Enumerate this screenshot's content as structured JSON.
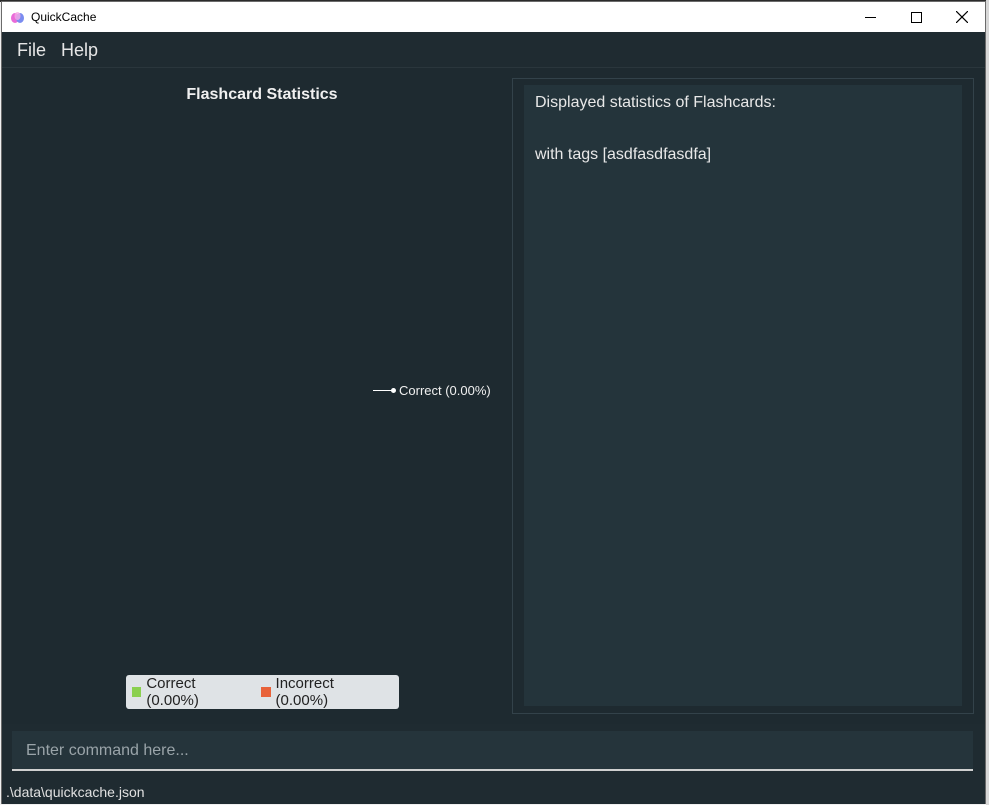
{
  "window": {
    "title": "QuickCache"
  },
  "menu": {
    "items": [
      {
        "label": "File"
      },
      {
        "label": "Help"
      }
    ]
  },
  "chart": {
    "title": "Flashcard Statistics",
    "slice_label": "Correct (0.00%)",
    "legend": [
      {
        "label": "Correct (0.00%)",
        "color": "#8ad04f"
      },
      {
        "label": "Incorrect (0.00%)",
        "color": "#e8623a"
      }
    ]
  },
  "chart_data": {
    "type": "pie",
    "title": "Flashcard Statistics",
    "categories": [
      "Correct",
      "Incorrect"
    ],
    "values": [
      0.0,
      0.0
    ],
    "legend_position": "bottom"
  },
  "stats": {
    "heading": "Displayed statistics of Flashcards:",
    "filter": "with tags [asdfasdfasdfa]"
  },
  "command": {
    "placeholder": "Enter command here...",
    "value": ""
  },
  "status": {
    "file_path": ".\\data\\quickcache.json"
  }
}
